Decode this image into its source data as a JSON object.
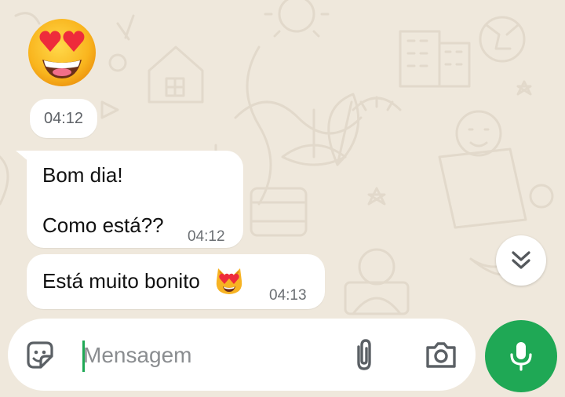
{
  "colors": {
    "background": "#efe8dc",
    "bubble": "#ffffff",
    "accent_green": "#1fa855",
    "meta_text": "#6b6f73"
  },
  "messages": {
    "sticker": {
      "icon": "heart-eyes-emoji"
    },
    "sticker_time": "04:12",
    "message1": {
      "line1": "Bom dia!",
      "line2": "Como está??",
      "time": "04:12"
    },
    "message2": {
      "text": "Está muito bonito",
      "emoji": "heart-eyes-cat-emoji",
      "time": "04:13"
    }
  },
  "scroll_button": {
    "icon": "double-chevron-down-icon"
  },
  "composer": {
    "placeholder": "Mensagem",
    "value": "",
    "sticker_icon": "sticker-icon",
    "attach_icon": "paperclip-icon",
    "camera_icon": "camera-icon",
    "mic_icon": "microphone-icon"
  }
}
